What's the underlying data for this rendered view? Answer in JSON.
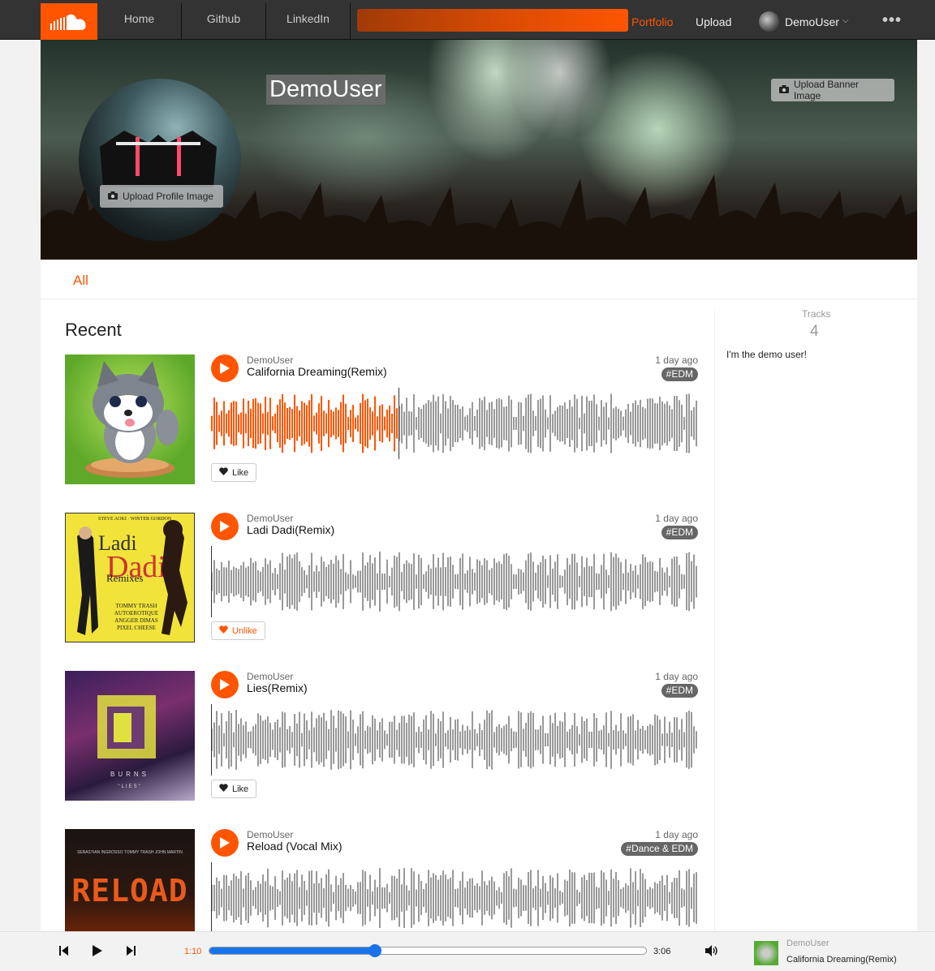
{
  "nav": {
    "links": [
      "Home",
      "Github",
      "LinkedIn"
    ],
    "portfolio": "Portfolio",
    "upload": "Upload",
    "user": "DemoUser"
  },
  "profile": {
    "username": "DemoUser",
    "upload_profile": "Upload Profile Image",
    "upload_banner": "Upload Banner Image"
  },
  "tabs": {
    "all": "All"
  },
  "section_title": "Recent",
  "sidebar": {
    "tracks_label": "Tracks",
    "tracks_count": "4",
    "bio": "I'm the demo user!"
  },
  "tracks": [
    {
      "artist": "DemoUser",
      "title": "California Dreaming(Remix)",
      "ago": "1 day ago",
      "tag": "#EDM",
      "like": "Like",
      "liked": false,
      "progress": 0.385
    },
    {
      "artist": "DemoUser",
      "title": "Ladi Dadi(Remix)",
      "ago": "1 day ago",
      "tag": "#EDM",
      "like": "Unlike",
      "liked": true,
      "progress": 0
    },
    {
      "artist": "DemoUser",
      "title": "Lies(Remix)",
      "ago": "1 day ago",
      "tag": "#EDM",
      "like": "Like",
      "liked": false,
      "progress": 0
    },
    {
      "artist": "DemoUser",
      "title": "Reload (Vocal Mix)",
      "ago": "1 day ago",
      "tag": "#Dance & EDM",
      "like": "",
      "liked": false,
      "progress": 0
    }
  ],
  "art_text": {
    "ladi_top": "STEVE AOKI · WINTER GORDON",
    "ladi_title1": "Ladi",
    "ladi_title2": "Dadi",
    "ladi_sub": "Remixes",
    "ladi_credits": [
      "TOMMY TRASH",
      "AUTOEROTIQUE",
      "ANGGER DIMAS",
      "PIXEL CHEESE"
    ],
    "lies_artist": "BURNS",
    "lies_title": "\"LIES\"",
    "reload_credits": "SEBASTIAN INGROSSO   TOMMY TRASH   JOHN MARTIN",
    "reload_title": "RELOAD"
  },
  "player": {
    "current": "1:10",
    "duration": "3:06",
    "progress": 0.38,
    "artist": "DemoUser",
    "title": "California Dreaming(Remix)"
  },
  "colors": {
    "accent": "#ff5500",
    "wave_gray": "#999999",
    "progress_blue": "#1a73e8"
  }
}
